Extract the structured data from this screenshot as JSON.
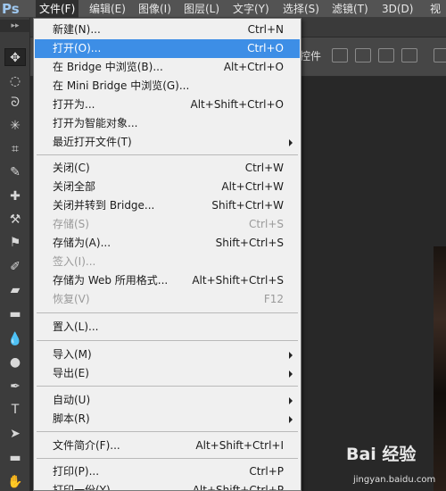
{
  "app": {
    "logo": "Ps"
  },
  "menubar": {
    "items": [
      {
        "label": "文件(F)",
        "active": true
      },
      {
        "label": "编辑(E)"
      },
      {
        "label": "图像(I)"
      },
      {
        "label": "图层(L)"
      },
      {
        "label": "文字(Y)"
      },
      {
        "label": "选择(S)"
      },
      {
        "label": "滤镜(T)"
      },
      {
        "label": "3D(D)"
      },
      {
        "label": "视"
      }
    ]
  },
  "optionsbar": {
    "label": "控件"
  },
  "tools_header": "▸▸",
  "file_menu": {
    "items": [
      {
        "label": "新建(N)...",
        "shortcut": "Ctrl+N"
      },
      {
        "label": "打开(O)...",
        "shortcut": "Ctrl+O",
        "highlight": true
      },
      {
        "label": "在 Bridge 中浏览(B)...",
        "shortcut": "Alt+Ctrl+O"
      },
      {
        "label": "在 Mini Bridge 中浏览(G)...",
        "shortcut": ""
      },
      {
        "label": "打开为...",
        "shortcut": "Alt+Shift+Ctrl+O"
      },
      {
        "label": "打开为智能对象...",
        "shortcut": ""
      },
      {
        "label": "最近打开文件(T)",
        "shortcut": "",
        "submenu": true
      },
      {
        "label": "关闭(C)",
        "shortcut": "Ctrl+W"
      },
      {
        "label": "关闭全部",
        "shortcut": "Alt+Ctrl+W"
      },
      {
        "label": "关闭并转到 Bridge...",
        "shortcut": "Shift+Ctrl+W"
      },
      {
        "label": "存储(S)",
        "shortcut": "Ctrl+S",
        "disabled": true
      },
      {
        "label": "存储为(A)...",
        "shortcut": "Shift+Ctrl+S"
      },
      {
        "label": "签入(I)...",
        "shortcut": "",
        "disabled": true
      },
      {
        "label": "存储为 Web 所用格式...",
        "shortcut": "Alt+Shift+Ctrl+S"
      },
      {
        "label": "恢复(V)",
        "shortcut": "F12",
        "disabled": true
      },
      {
        "label": "置入(L)...",
        "shortcut": ""
      },
      {
        "label": "导入(M)",
        "shortcut": "",
        "submenu": true
      },
      {
        "label": "导出(E)",
        "shortcut": "",
        "submenu": true
      },
      {
        "label": "自动(U)",
        "shortcut": "",
        "submenu": true
      },
      {
        "label": "脚本(R)",
        "shortcut": "",
        "submenu": true
      },
      {
        "label": "文件简介(F)...",
        "shortcut": "Alt+Shift+Ctrl+I"
      },
      {
        "label": "打印(P)...",
        "shortcut": "Ctrl+P"
      },
      {
        "label": "打印一份(Y)",
        "shortcut": "Alt+Shift+Ctrl+P"
      }
    ]
  },
  "watermark": {
    "logo": "Bai 经验",
    "url": "jingyan.baidu.com"
  }
}
